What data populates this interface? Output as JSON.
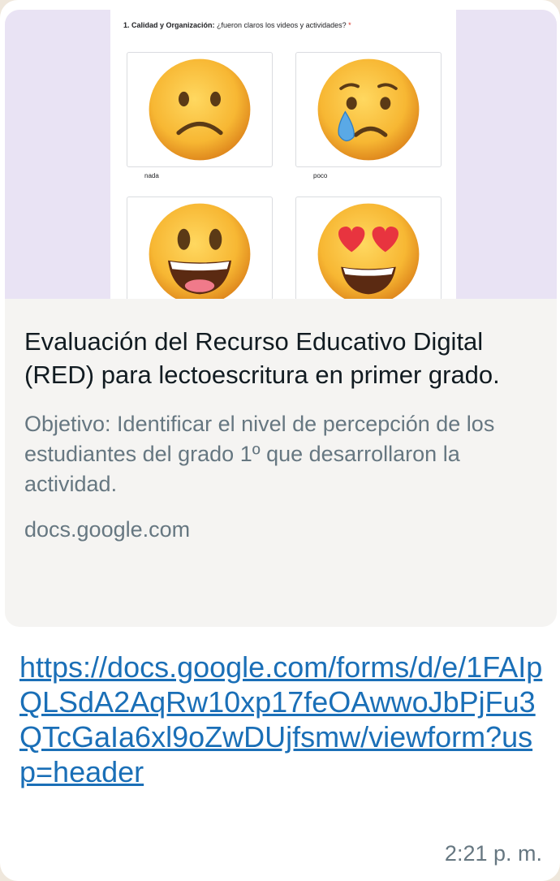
{
  "preview": {
    "question_number": "1. Calidad y Organización:",
    "question_text": " ¿fueron claros los videos y actividades?",
    "required_mark": "*",
    "options": [
      {
        "label": "nada",
        "icon": "frowning-face-emoji"
      },
      {
        "label": "poco",
        "icon": "crying-face-emoji"
      },
      {
        "label": "",
        "icon": "grinning-face-emoji"
      },
      {
        "label": "",
        "icon": "heart-eyes-emoji"
      }
    ]
  },
  "card": {
    "title": "Evaluación del Recurso Educativo Digital (RED) para lectoescritura en primer grado.",
    "description": "Objetivo: Identificar el nivel de percepción de los estudiantes del grado 1º que desarrollaron la actividad.",
    "domain": "docs.google.com"
  },
  "message": {
    "link": "https://docs.google.com/forms/d/e/1FAIpQLSdA2AqRw10xp17feOAwwoJbPjFu3QTcGaIa6xl9oZwDUjfsmw/viewform?usp=header",
    "time": "2:21 p. m."
  },
  "colors": {
    "link": "#1a6fb7",
    "secondary_text": "#667781",
    "card_bg": "#f5f4f2",
    "image_bg": "#e9e3f4"
  }
}
